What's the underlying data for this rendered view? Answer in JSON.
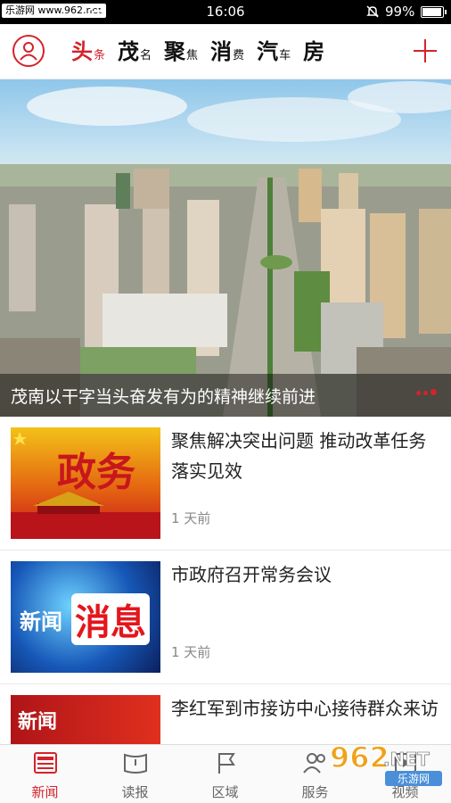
{
  "status_bar": {
    "watermark": "乐游网 www.962.net",
    "time": "16:06",
    "battery_text": "99%",
    "battery_level": 0.99
  },
  "header": {
    "tabs": [
      {
        "big": "头",
        "small": "条",
        "active": true
      },
      {
        "big": "茂",
        "small": "名",
        "active": false
      },
      {
        "big": "聚",
        "small": "焦",
        "active": false
      },
      {
        "big": "消",
        "small": "费",
        "active": false
      },
      {
        "big": "汽",
        "small": "车",
        "active": false
      },
      {
        "big": "房",
        "small": "",
        "active": false
      }
    ],
    "accent_color": "#d4232b"
  },
  "hero": {
    "caption": "茂南以干字当头奋发有为的精神继续前进",
    "dot_count": 3,
    "active_dot": 2
  },
  "news": [
    {
      "title": "聚焦解决突出问题 推动改革任务落实见效",
      "time": "1 天前",
      "thumb_text": "政务"
    },
    {
      "title": "市政府召开常务会议",
      "time": "1 天前",
      "thumb_text_a": "新闻",
      "thumb_text_b": "消息"
    },
    {
      "title": "李红军到市接访中心接待群众来访",
      "time": "",
      "thumb_text": "新闻"
    }
  ],
  "bottom_nav": [
    {
      "label": "新闻",
      "icon": "newspaper-icon",
      "active": true
    },
    {
      "label": "读报",
      "icon": "paper-icon",
      "active": false
    },
    {
      "label": "区域",
      "icon": "flag-icon",
      "active": false
    },
    {
      "label": "服务",
      "icon": "people-icon",
      "active": false
    },
    {
      "label": "视频",
      "icon": "video-icon",
      "active": false
    }
  ],
  "site_watermark": {
    "logo": "962",
    "suffix": ".NET",
    "sub": "乐游网"
  }
}
